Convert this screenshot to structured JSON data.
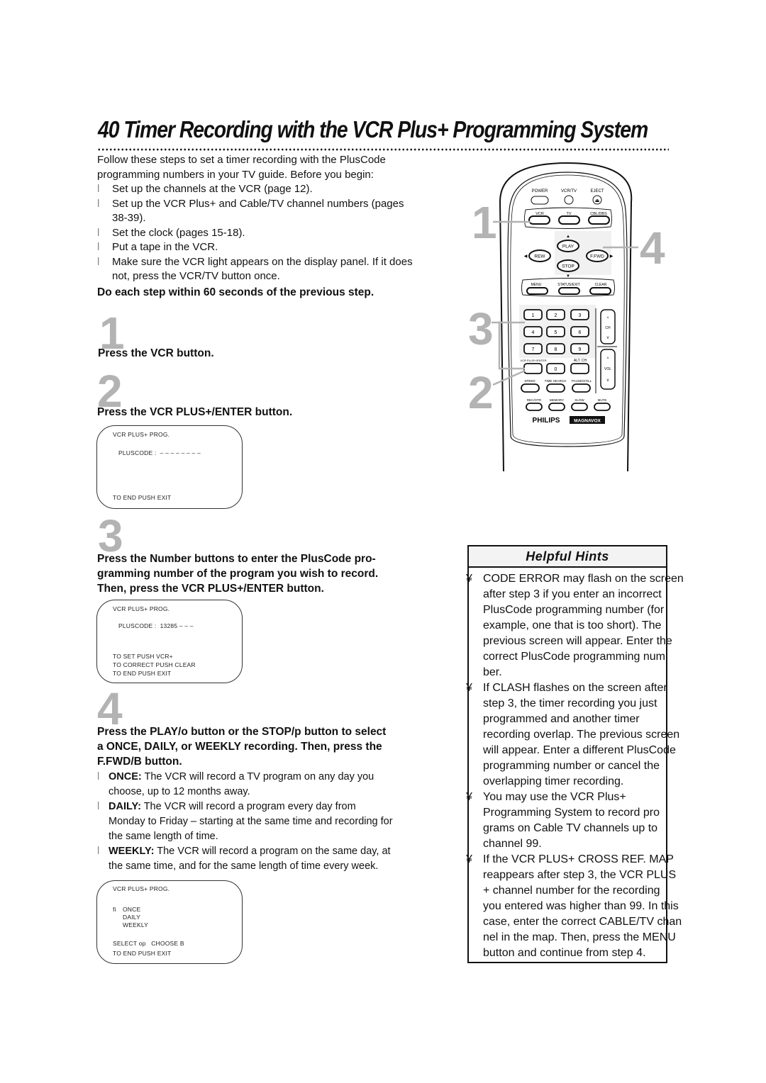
{
  "page": {
    "title": "40  Timer Recording with the VCR Plus+ Programming System"
  },
  "intro": {
    "lines": [
      "Follow these steps to set a timer recording with the PlusCode",
      "programming numbers in your TV guide. Before you begin:"
    ],
    "bullet_marker": "l",
    "bullets": [
      [
        "Set up the channels at the VCR (page 12)."
      ],
      [
        "Set up the VCR Plus+ and Cable/TV channel numbers (pages",
        "38-39)."
      ],
      [
        "Set the clock (pages 15-18)."
      ],
      [
        "Put a tape in the VCR."
      ],
      [
        "Make sure the VCR light appears on the display panel. If it does",
        "not, press the VCR/TV button once."
      ]
    ],
    "note": "Do each step within 60 seconds of the previous step."
  },
  "steps": [
    {
      "number": "1",
      "text": "Press the VCR button."
    },
    {
      "number": "2",
      "text": "Press the VCR PLUS+/ENTER button.",
      "screen": {
        "line1": "VCR PLUS+ PROG.",
        "line2": "PLUSCODE :  – – – – – – – –",
        "line3": "TO END PUSH EXIT"
      }
    },
    {
      "number": "3",
      "text_lines": [
        "Press the Number buttons to enter the PlusCode pro-",
        "gramming number of the program you wish to record.",
        "Then, press the VCR PLUS+/ENTER button."
      ],
      "screen": {
        "line1": "VCR PLUS+ PROG.",
        "line2": "PLUSCODE :  13285 – – –",
        "line3": "TO SET PUSH VCR+",
        "line4": "TO CORRECT PUSH CLEAR",
        "line5": "TO END PUSH EXIT"
      }
    },
    {
      "number": "4",
      "text_lines": [
        "Press the PLAY/o  button or the STOP/p  button to select",
        "a ONCE, DAILY, or WEEKLY recording. Then, press the",
        "F.FWD/B  button."
      ],
      "options": [
        {
          "label": "ONCE:",
          "desc_lines": [
            "The VCR will record a TV program on any day you",
            "choose, up to 12 months away."
          ]
        },
        {
          "label": "DAILY:",
          "desc_lines": [
            "The VCR will record a program every day from",
            "Monday to Friday – starting at the same time and recording for",
            "the same length of time."
          ]
        },
        {
          "label": "WEEKLY:",
          "desc_lines": [
            "The VCR will record a program on the same day, at",
            "the same time, and for the same length of time every week."
          ]
        }
      ],
      "screen": {
        "line1": "VCR PLUS+ PROG.",
        "cursor": "fi",
        "opt1": "ONCE",
        "opt2": "DAILY",
        "opt3": "WEEKLY",
        "line_select": "SELECT op   CHOOSE B",
        "line_end": "TO END PUSH EXIT"
      }
    }
  ],
  "hints": {
    "title": "Helpful Hints",
    "marker": "¥",
    "items": [
      [
        "CODE ERROR may flash on the screen",
        "after step 3 if you enter an incorrect",
        "PlusCode programming number (for",
        "example, one that is too short). The",
        "previous screen will appear. Enter the",
        "correct PlusCode programming num",
        "ber."
      ],
      [
        "If CLASH flashes on the screen after",
        "step 3, the timer recording you just",
        "programmed and another timer",
        "recording overlap. The previous screen",
        "will appear. Enter a different PlusCode",
        "programming number or cancel the",
        "overlapping timer recording."
      ],
      [
        "You may use the VCR Plus+",
        "Programming System to record pro",
        "grams on Cable TV channels up to",
        "channel 99."
      ],
      [
        "If the VCR PLUS+ CROSS REF. MAP",
        "reappears after step 3, the VCR PLUS",
        "+ channel number for the recording",
        "you entered was higher than 99. In this",
        "case, enter the correct CABLE/TV chan",
        "nel in the map. Then, press the MENU",
        "button and continue from step 4."
      ]
    ]
  },
  "remote": {
    "callouts": [
      "1",
      "4",
      "3",
      "2"
    ],
    "row1": [
      "POWER",
      "VCR/TV",
      "EJECT"
    ],
    "row2": [
      "VCR",
      "TV",
      "CBL/DBS"
    ],
    "transport": {
      "play": "PLAY",
      "stop": "STOP",
      "rew": "REW",
      "ffwd": "F.FWD"
    },
    "row3": [
      "MENU",
      "STATUS/EXIT",
      "CLEAR"
    ],
    "digits": [
      "1",
      "2",
      "3",
      "4",
      "5",
      "6",
      "7",
      "8",
      "9"
    ],
    "zero": "0",
    "vcr_plus_enter": "VCR PLUS+/ENTER",
    "alt_ch": "ALT. CH",
    "ch": "CH",
    "vol": "VOL",
    "row_speed": [
      "SPEED",
      "TIME SEARCH",
      "PAUSE/STILL"
    ],
    "row_bottom": [
      "REC/OTR",
      "MEMORY",
      "SLOW",
      "MUTE"
    ],
    "brand1": "PHILIPS",
    "brand2": "MAGNAVOX"
  }
}
